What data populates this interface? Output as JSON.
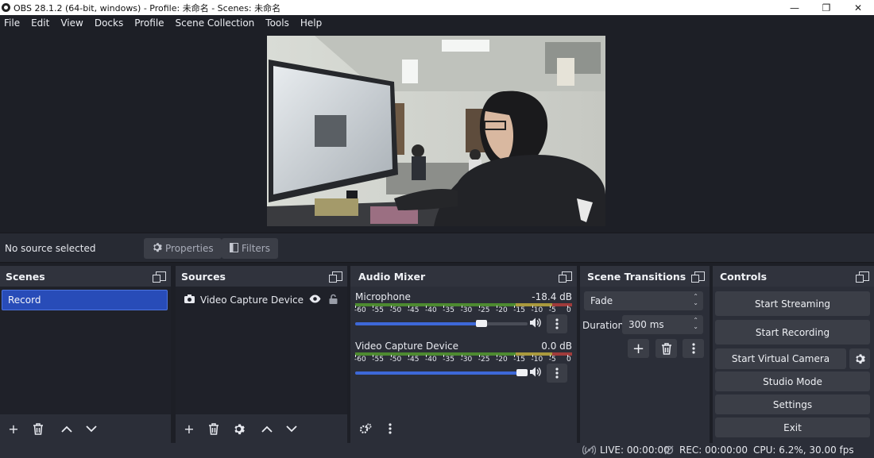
{
  "window": {
    "title": "OBS 28.1.2 (64-bit, windows) - Profile: 未命名 - Scenes: 未命名",
    "minimize": "—",
    "restore": "❐",
    "close": "✕"
  },
  "menu": [
    "File",
    "Edit",
    "View",
    "Docks",
    "Profile",
    "Scene Collection",
    "Tools",
    "Help"
  ],
  "source_toolbar": {
    "status": "No source selected",
    "properties": "Properties",
    "filters": "Filters"
  },
  "scenes": {
    "title": "Scenes",
    "items": [
      "Record"
    ]
  },
  "sources": {
    "title": "Sources",
    "items": [
      {
        "name": "Video Capture Device",
        "icon": "camera-icon",
        "visible": true,
        "locked": false
      }
    ]
  },
  "audio": {
    "title": "Audio Mixer",
    "ticks": [
      "-60",
      "-55",
      "-50",
      "-45",
      "-40",
      "-35",
      "-30",
      "-25",
      "-20",
      "-15",
      "-10",
      "-5",
      "0"
    ],
    "channels": [
      {
        "name": "Microphone",
        "db": "-18.4 dB",
        "volume": 0.75
      },
      {
        "name": "Video Capture Device",
        "db": "0.0 dB",
        "volume": 1.0
      }
    ]
  },
  "transitions": {
    "title": "Scene Transitions",
    "transition": "Fade",
    "duration_label": "Duration",
    "duration": "300 ms"
  },
  "controls": {
    "title": "Controls",
    "start_streaming": "Start Streaming",
    "start_recording": "Start Recording",
    "start_virtual_camera": "Start Virtual Camera",
    "studio_mode": "Studio Mode",
    "settings": "Settings",
    "exit": "Exit"
  },
  "status": {
    "live": "LIVE: 00:00:00",
    "rec": "REC: 00:00:00",
    "cpu": "CPU: 6.2%, 30.00 fps"
  },
  "colors": {
    "accent": "#284cb8",
    "background": "#1d1f26",
    "panel": "#2b2e38"
  }
}
